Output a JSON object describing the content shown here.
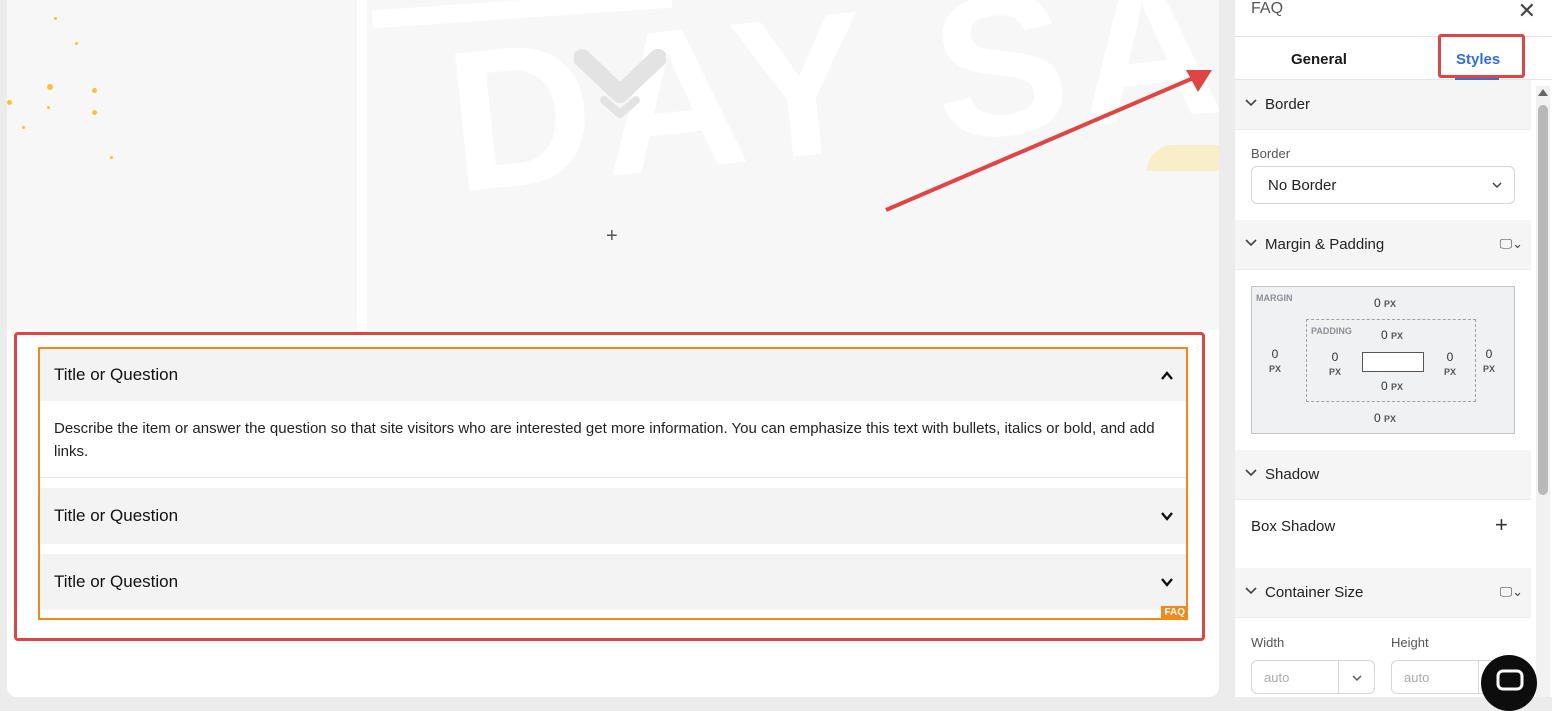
{
  "hero": {
    "background_word": "DAY SAAS"
  },
  "faq": {
    "badge": "FAQ",
    "items": [
      {
        "question": "Title or Question",
        "expanded": true,
        "answer": "Describe the item or answer the question so that site visitors who are interested get more information. You can emphasize this text with bullets, italics or bold, and add links."
      },
      {
        "question": "Title or Question",
        "expanded": false
      },
      {
        "question": "Title or Question",
        "expanded": false
      }
    ]
  },
  "panel": {
    "title": "FAQ",
    "tabs": {
      "general": "General",
      "styles": "Styles"
    },
    "sections": {
      "border": {
        "label": "Border",
        "field_label": "Border",
        "value": "No Border"
      },
      "margin_padding": {
        "label": "Margin & Padding",
        "margin_tag": "MARGIN",
        "padding_tag": "PADDING",
        "unit": "PX",
        "margin": {
          "top": "0",
          "right": "0",
          "bottom": "0",
          "left": "0"
        },
        "padding": {
          "top": "0",
          "right": "0",
          "bottom": "0",
          "left": "0"
        }
      },
      "shadow": {
        "label": "Shadow",
        "box_shadow": "Box Shadow"
      },
      "container_size": {
        "label": "Container Size",
        "width_label": "Width",
        "height_label": "Height",
        "width_placeholder": "auto",
        "height_placeholder": "auto"
      }
    }
  },
  "colors": {
    "accent": "#2f6fe0",
    "highlight": "#e04545",
    "faq_outline": "#f08a1c"
  }
}
